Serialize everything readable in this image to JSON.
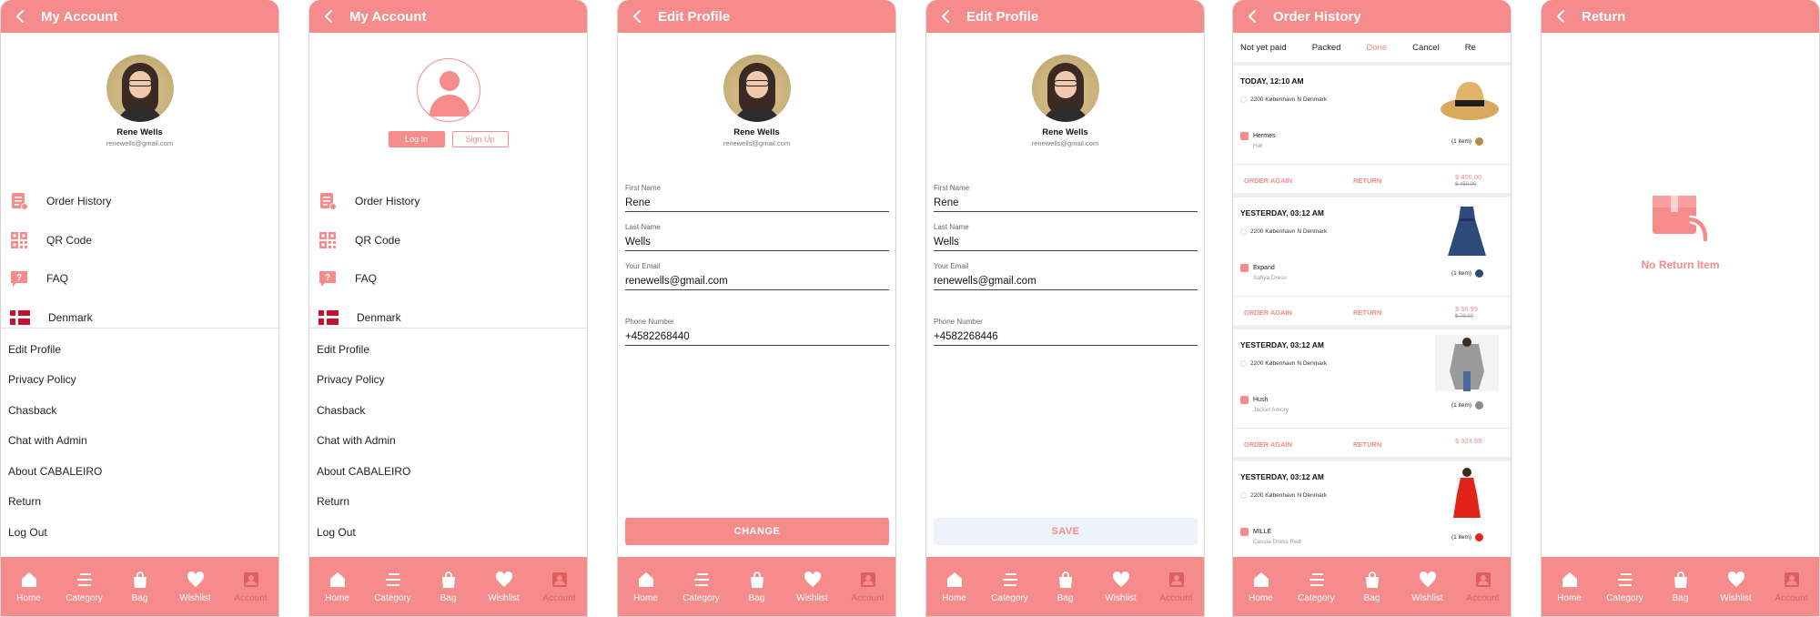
{
  "colors": {
    "accent": "#f68b8b",
    "accent_dark": "#e05e5e"
  },
  "nav": [
    "Home",
    "Category",
    "Bag",
    "Wishlist",
    "Account"
  ],
  "screens": {
    "my_account": {
      "title": "My Account",
      "name": "Rene Wells",
      "email": "renewells@gmail.com",
      "menu": [
        "Order History",
        "QR Code",
        "FAQ",
        "Denmark"
      ],
      "links": [
        "Edit Profile",
        "Privacy Policy",
        "Chasback",
        "Chat with Admin",
        "About CABALEIRO",
        "Return",
        "Log Out"
      ]
    },
    "my_account_guest": {
      "title": "My Account",
      "login_label": "Log In",
      "signup_label": "Sign Up"
    },
    "edit_profile": {
      "title": "Edit Profile",
      "name": "Rene Wells",
      "email": "renewells@gmail.com",
      "fields": [
        {
          "label": "First Name",
          "value": "Rene"
        },
        {
          "label": "Last Name",
          "value": "Wells"
        },
        {
          "label": "Your Email",
          "value": "renewells@gmail.com"
        },
        {
          "label": "Phone Number",
          "value": "+4582268440"
        }
      ],
      "button": "CHANGE"
    },
    "edit_profile_save": {
      "title": "Edit Profile",
      "phone_value": "+4582268446",
      "button": "SAVE"
    },
    "order_history": {
      "title": "Order History",
      "tabs": [
        "Not yet paid",
        "Packed",
        "Done",
        "Cancel",
        "Re"
      ],
      "active_tab": "Done",
      "order_again": "ORDER AGAIN",
      "return_label": "RETURN",
      "orders": [
        {
          "date": "TODAY, 12:10 AM",
          "address": "2200 København N Denmark",
          "brand": "Hermes",
          "product": "Hat",
          "items": "(1 item)",
          "color": "#b58a4c",
          "price": "$ 400.00",
          "old_price": "$ 450.00"
        },
        {
          "date": "YESTERDAY, 03:12 AM",
          "address": "2200 København N Denmark",
          "brand": "Expand",
          "product": "Safiya Dress",
          "items": "(1 item)",
          "color": "#2d4a7a",
          "price": "$ 56.99",
          "old_price": "$ 79.00"
        },
        {
          "date": "YESTERDAY, 03:12 AM",
          "address": "2200 København N Denmark",
          "brand": "Hush",
          "product": "Jacket Amory",
          "items": "(1 item)",
          "color": "#8a8a8a",
          "price": "$ 324.99",
          "old_price": ""
        },
        {
          "date": "YESTERDAY, 03:12 AM",
          "address": "2200 København N Denmark",
          "brand": "MILLE",
          "product": "Cassia Dress Red",
          "items": "(1 item)",
          "color": "#e2231a",
          "price": "",
          "old_price": ""
        }
      ]
    },
    "return": {
      "title": "Return",
      "empty_text": "No Return Item"
    }
  }
}
